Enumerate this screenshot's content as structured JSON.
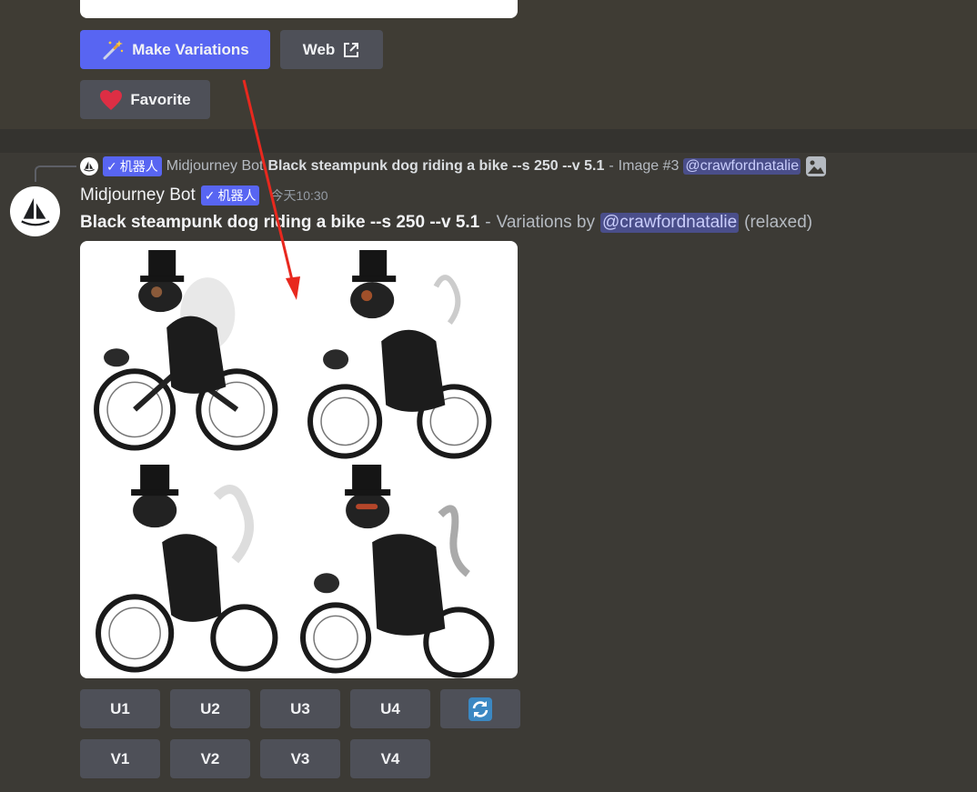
{
  "previous_message": {
    "make_variations_label": "Make Variations",
    "web_label": "Web",
    "favorite_label": "Favorite"
  },
  "reply": {
    "bot_badge": "机器人",
    "author": "Midjourney Bot",
    "prompt": "Black steampunk dog riding a bike --s 250 --v 5.1",
    "separator": "-",
    "image_ref": "Image #3",
    "mention": "@crawfordnatalie"
  },
  "message": {
    "author": "Midjourney Bot",
    "bot_badge": "机器人",
    "timestamp": "今天10:30",
    "prompt": "Black steampunk dog riding a bike --s 250 --v 5.1",
    "separator": "-",
    "variations_by": "Variations by",
    "mention": "@crawfordnatalie",
    "mode": "(relaxed)"
  },
  "buttons": {
    "upscale": [
      "U1",
      "U2",
      "U3",
      "U4"
    ],
    "variation": [
      "V1",
      "V2",
      "V3",
      "V4"
    ],
    "reroll_icon": "refresh-icon"
  },
  "colors": {
    "blurple": "#5865f2",
    "button_gray": "#4e5058",
    "annotation_arrow": "#e8281e"
  }
}
